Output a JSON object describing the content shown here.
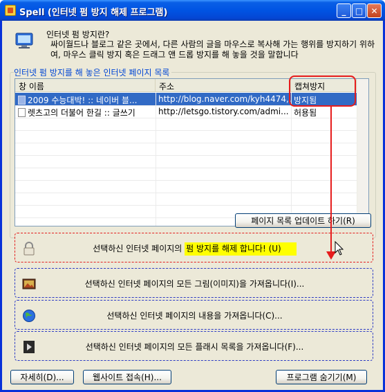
{
  "window": {
    "title": "Spell (인터넷 펌 방지 해제 프로그램)",
    "controls": {
      "minimize": "_",
      "maximize": "□",
      "close": "✕"
    }
  },
  "info": {
    "icon": "monitor-icon",
    "title": "인터넷 펌 방지란?",
    "description": "싸이월드나 블로그 같은 곳에서, 다른 사람의 글을 마우스로 복사해 가는 행위를 방지하기 위하여, 마우스 클릭 방지 혹은 드래그 앤 드롭 방지를 해 놓을 것을 말합니다"
  },
  "pages_group": {
    "label": "인터넷 펌 방지를 해 놓은 인터넷 페이지 목록",
    "columns": [
      "창 이름",
      "주소",
      "캡쳐방지"
    ],
    "rows": [
      {
        "name": "2009 수능대박! :: 네이버 블...",
        "url": "http://blog.naver.com/kyh4474,...",
        "status": "방지됨",
        "selected": true
      },
      {
        "name": "렛츠고의 더불어 한길 :: 글쓰기",
        "url": "http://letsgo.tistory.com/admi...",
        "status": "허용됨",
        "selected": false
      }
    ],
    "update_button": "페이지 목록 업데이트 하기(R)"
  },
  "actions": [
    {
      "icon": "lock-icon",
      "prefix": "선택하신 인터넷 페이지의 ",
      "label": "펌 방지를 해제 합니다! (U)"
    },
    {
      "icon": "picture-icon",
      "label": "선택하신 인터넷 페이지의 모든 그림(이미지)을 가져옵니다(I)..."
    },
    {
      "icon": "globe-icon",
      "label": "선택하신 인터넷 페이지의 내용을 가져옵니다(C)..."
    },
    {
      "icon": "film-icon",
      "label": "선택하신 인터넷 페이지의 모든 플래시 목록을 가져옵니다(F)..."
    }
  ],
  "footer": {
    "more_button": "자세히(D)...",
    "website_button": "웹사이트 접속(H)...",
    "hide_button": "프로그램 숨기기(M)"
  },
  "colors": {
    "title_bar": "#0054e3",
    "selection": "#316ac5",
    "annotation": "#e61c1c",
    "highlight": "#ffff00",
    "group_label": "#0046d5"
  }
}
